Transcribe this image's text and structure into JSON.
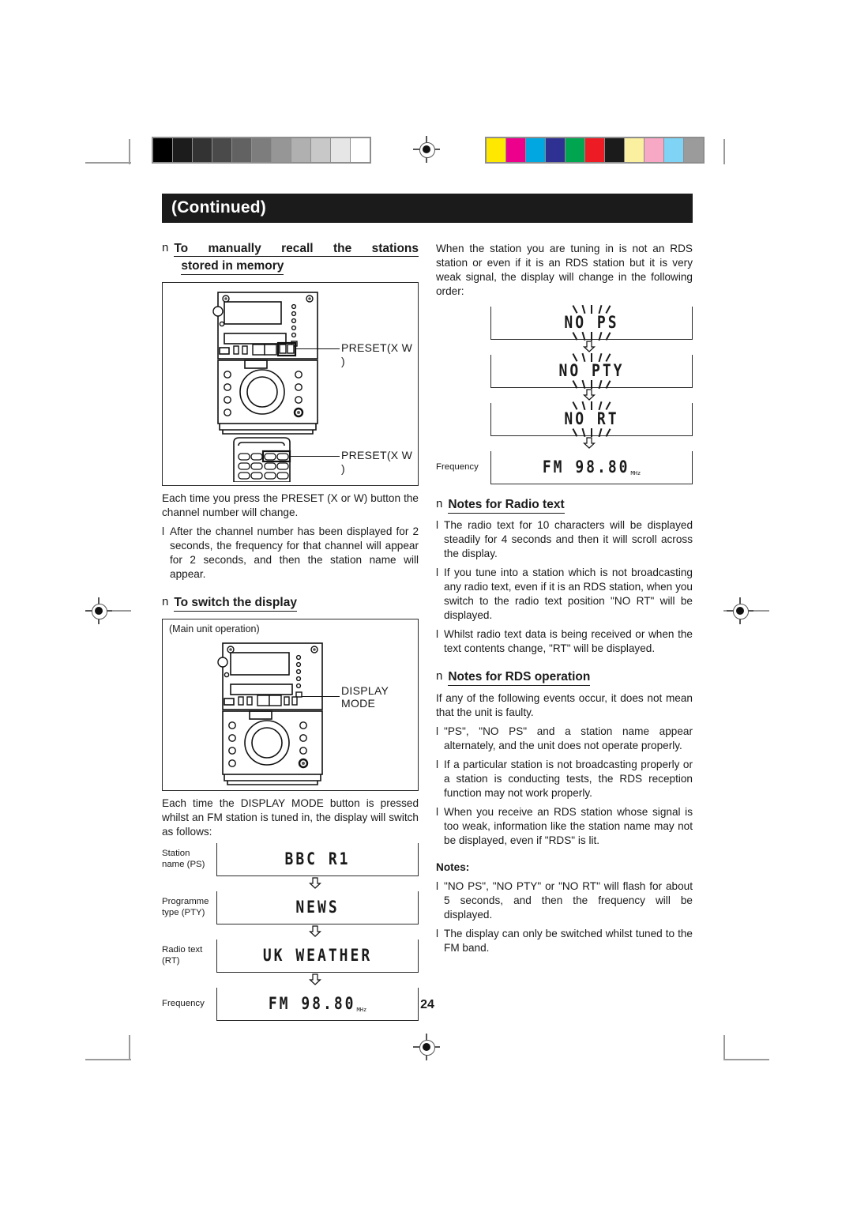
{
  "page": {
    "number": "24",
    "banner": "(Continued)"
  },
  "calibration": {
    "gray_wedge": [
      "#000000",
      "#1c1c1c",
      "#333333",
      "#4a4a4a",
      "#626262",
      "#7d7d7d",
      "#969696",
      "#b0b0b0",
      "#c8c8c8",
      "#e6e6e6",
      "#ffffff"
    ],
    "color_patches": [
      "#ffe800",
      "#ec008c",
      "#00a7e1",
      "#2e3192",
      "#00a550",
      "#ed1c24",
      "#1b1b1b",
      "#faf0a0",
      "#f7a8c4",
      "#7fd4f5",
      "#9b9b9b"
    ]
  },
  "left_column": {
    "heading1": {
      "marker": "n",
      "line1": "To manually recall the stations",
      "line2": "stored in memory"
    },
    "illustration1": {
      "callout_main": "PRESET(X  W )",
      "callout_remote": "PRESET(X  W )"
    },
    "body1": "Each time you press the PRESET (X  or W) button the channel number will change.",
    "bullets1": [
      "After the channel number has been displayed for 2 seconds, the frequency for that channel will appear for 2 seconds, and then the station name will appear."
    ],
    "heading2": {
      "marker": "n",
      "text": "To switch the display"
    },
    "illustration2": {
      "caption": "(Main unit operation)",
      "callout_line1": "DISPLAY",
      "callout_line2": "MODE"
    },
    "body2": "Each time the DISPLAY MODE button is pressed whilst an FM station is tuned in, the display will switch as follows:",
    "display_sequence": [
      {
        "label_line1": "Station",
        "label_line2": "name (PS)",
        "lcd": "BBC R1",
        "unit": "",
        "flashing": false
      },
      {
        "label_line1": "Programme",
        "label_line2": "type (PTY)",
        "lcd": "NEWS",
        "unit": "",
        "flashing": false
      },
      {
        "label_line1": "Radio text",
        "label_line2": "(RT)",
        "lcd": "UK WEATHER",
        "unit": "",
        "flashing": false
      },
      {
        "label_line1": "Frequency",
        "label_line2": "",
        "lcd": "FM    98.80",
        "unit": "MHz",
        "flashing": false
      }
    ]
  },
  "right_column": {
    "intro": "When the station you are tuning in is not an RDS station or even if it is an RDS station but it is very weak signal, the display will change in the following order:",
    "display_sequence": [
      {
        "label": "",
        "lcd": "NO PS",
        "unit": "",
        "flashing": true
      },
      {
        "label": "",
        "lcd": "NO PTY",
        "unit": "",
        "flashing": true
      },
      {
        "label": "",
        "lcd": "NO RT",
        "unit": "",
        "flashing": true
      },
      {
        "label": "Frequency",
        "lcd": "FM    98.80",
        "unit": "MHz",
        "flashing": false
      }
    ],
    "heading_radiotext": {
      "marker": "n",
      "text": "Notes for Radio text"
    },
    "bullets_radiotext": [
      "The radio text for 10 characters will be displayed steadily for 4 seconds and then it will scroll across the display.",
      "If you tune into a station which is not broadcasting any radio text, even if it is an RDS station, when you switch to the radio text position \"NO RT\" will be displayed.",
      "Whilst radio text data is being received or when the text contents change, \"RT\" will be displayed."
    ],
    "heading_rds": {
      "marker": "n",
      "text": "Notes for RDS operation"
    },
    "rds_intro": "If any of the following events occur, it does not mean that the unit is faulty.",
    "bullets_rds": [
      "\"PS\", \"NO PS\" and a station name appear alternately, and the unit does not operate properly.",
      "If a particular station is not broadcasting properly or a station is conducting tests, the RDS reception function may not work properly.",
      "When you receive an RDS station whose signal is too weak, information like the station name may not be displayed, even if \"RDS\" is lit."
    ],
    "notes_heading": "Notes:",
    "bullets_notes": [
      "\"NO PS\", \"NO PTY\" or \"NO RT\" will flash for about 5 seconds, and then the frequency will be displayed.",
      "The display can only be switched whilst tuned to the FM band."
    ]
  }
}
